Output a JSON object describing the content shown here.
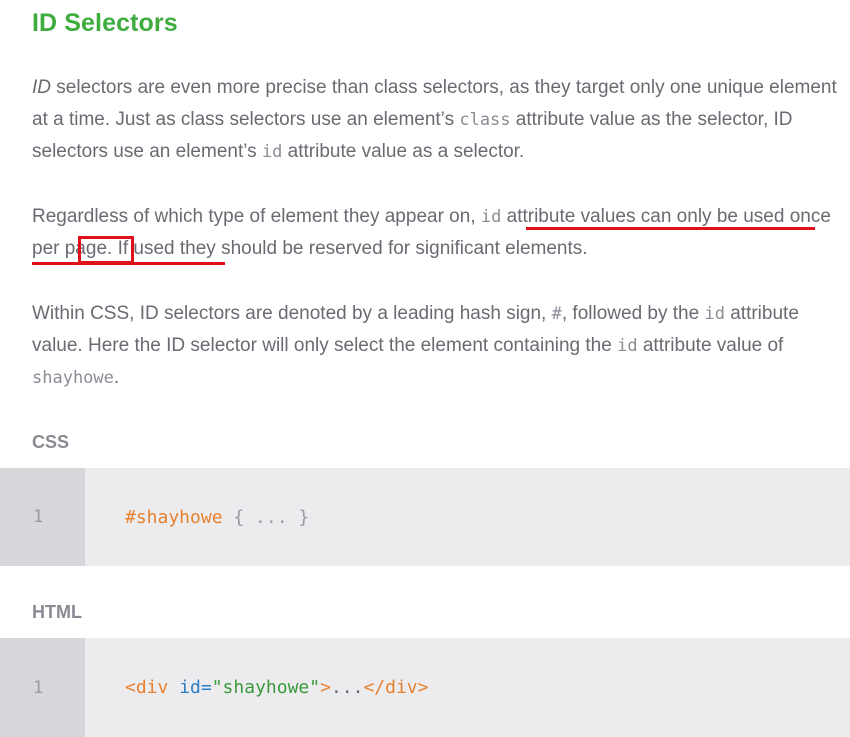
{
  "section": {
    "title": "ID Selectors"
  },
  "paragraph1": {
    "em": "ID",
    "text_a": " selectors are even more precise than class selectors, as they target only one unique element at a time. Just as class selectors use an element’s ",
    "code_class": "class",
    "text_b": " attribute value as the selector, ID selectors use an element’s ",
    "code_id": "id",
    "text_c": " attribute value as a selector."
  },
  "paragraph2": {
    "text_a": "Regardless of which type of element they appear on, ",
    "code_id": "id",
    "text_b": " attribute values can only be used once per page. If used they should be reserved for significant elements."
  },
  "paragraph3": {
    "text_a": "Within CSS, ID selectors are denoted by a leading hash sign, ",
    "code_hash": "#",
    "text_b": ", followed by the ",
    "code_id": "id",
    "text_c": " attribute value. Here the ID selector will only select the element containing the ",
    "code_id2": "id",
    "text_d": " attribute value of ",
    "code_value": "shayhowe",
    "text_e": "."
  },
  "css_example": {
    "label": "CSS",
    "line_number": "1",
    "selector": "#shayhowe",
    "body": " { ... }"
  },
  "html_example": {
    "label": "HTML",
    "line_number": "1",
    "tag_open": "<div",
    "attr_name": " id=",
    "attr_value": "\"shayhowe\"",
    "tag_close_a": ">",
    "inner": "...",
    "tag_end": "</div>"
  },
  "colors": {
    "title": "#3fac3f",
    "annotation": "#e0101b",
    "code_bg": "#ececef",
    "gutter_bg": "#d6d6db"
  }
}
